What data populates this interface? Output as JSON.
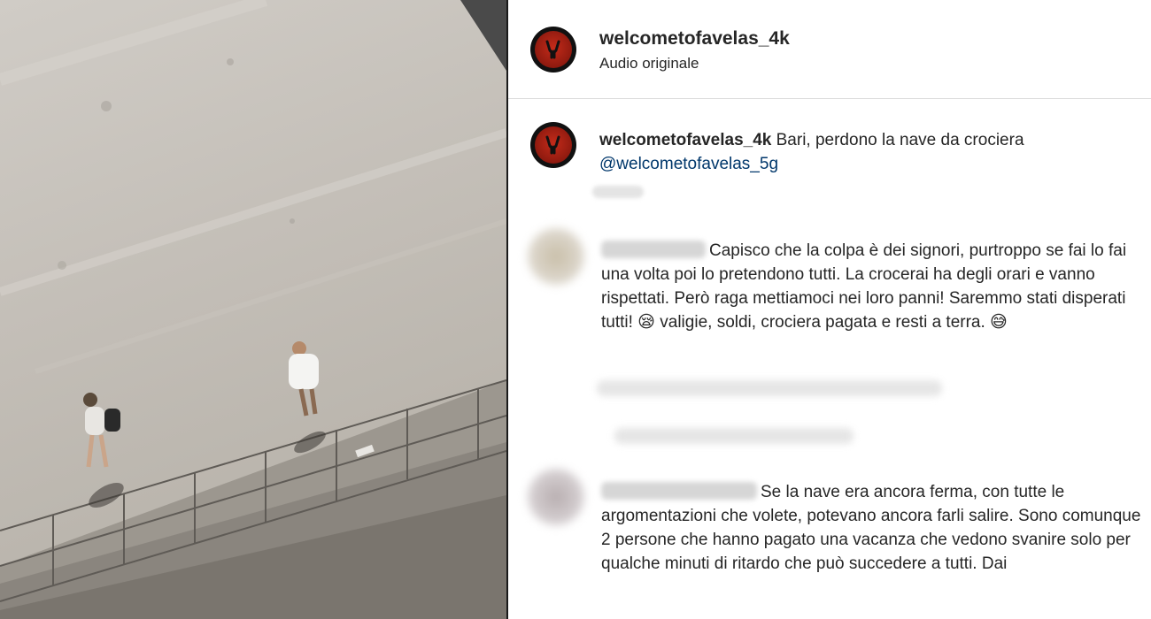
{
  "header": {
    "username": "welcometofavelas_4k",
    "subtitle": "Audio originale"
  },
  "caption": {
    "username": "welcometofavelas_4k",
    "text": " Bari, perdono la nave da crociera",
    "mention": "@welcometofavelas_5g"
  },
  "comments": [
    {
      "text": "Capisco che la colpa è dei signori, purtroppo se fai lo fai una volta poi lo pretendono tutti. La crocerai ha degli orari e vanno rispettati. Però raga mettiamoci nei loro panni! Saremmo stati disperati tutti! 😪 valigie, soldi, crociera pagata e resti a terra. 😅"
    },
    {
      "text": "Se la nave era ancora ferma, con tutte le argomentazioni che volete, potevano ancora farli salire. Sono comunque 2 persone che hanno pagato una vacanza che vedono svanire solo per qualche minuti di ritardo che può succedere a tutti. Dai"
    }
  ],
  "colors": {
    "mention": "#00376b",
    "avatar_red": "#c32b1a",
    "text": "#262626"
  },
  "icons": {
    "avatar": "hand-horns-logo-icon"
  }
}
